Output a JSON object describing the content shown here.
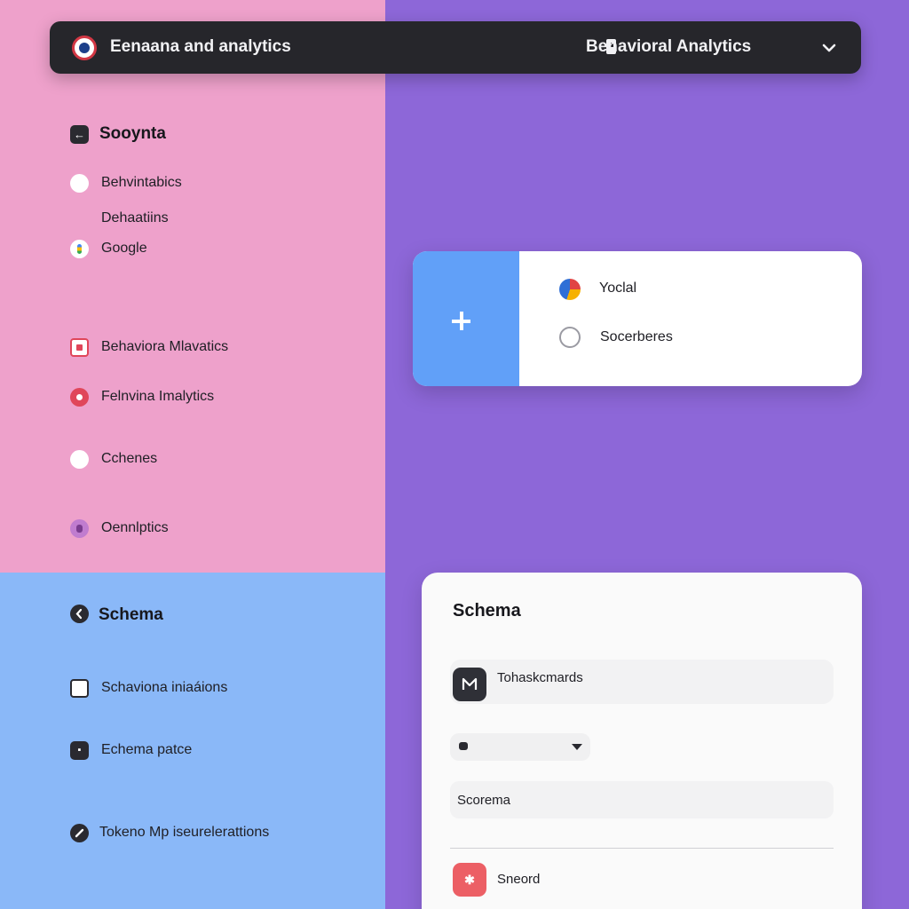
{
  "header": {
    "app_title": "Eenaana and analytics",
    "section_title": "Behavioral Analytics",
    "icons": {
      "logo": "brand-logo",
      "document": "document-icon",
      "dropdown": "chevron-down-icon"
    }
  },
  "sidebar_top": {
    "heading": "Sooynta",
    "items": [
      {
        "label": "Behvintabics",
        "icon": "white-circle-icon"
      },
      {
        "label": "Dehaatiins",
        "icon": ""
      },
      {
        "label": "Google",
        "icon": "google-icon"
      },
      {
        "label": "Behaviora Mlavatics",
        "icon": "red-square-icon"
      },
      {
        "label": "Felnvina Imalytics",
        "icon": "red-target-icon"
      },
      {
        "label": "Cchenes",
        "icon": "white-circle-icon"
      },
      {
        "label": "Oennlptics",
        "icon": "purple-circle-icon"
      }
    ]
  },
  "sidebar_bottom": {
    "heading": "Schema",
    "items": [
      {
        "label": "Schaviona iniaáions",
        "icon": "checkbox-icon"
      },
      {
        "label": "Echema patce",
        "icon": "box-icon"
      },
      {
        "label": "Tokeno Mp iseurelerattions",
        "icon": "pencil-icon"
      }
    ]
  },
  "option_card": {
    "add_icon": "plus-icon",
    "options": [
      {
        "label": "Yoclal",
        "icon": "pie-chart-icon"
      },
      {
        "label": "Socerberes",
        "icon": "radio-icon"
      }
    ]
  },
  "schema_card": {
    "title": "Schema",
    "row1_label": "Tohaskcmards",
    "select_value": "",
    "input_value": "Scorema",
    "row2_label": "Sneord"
  },
  "colors": {
    "pink_panel": "#eea1cb",
    "blue_panel": "#8ab8f8",
    "purple_panel": "#8d67d8",
    "topbar": "#26262b",
    "accent_blue": "#61a0f8",
    "accent_red": "#ec5f65"
  }
}
